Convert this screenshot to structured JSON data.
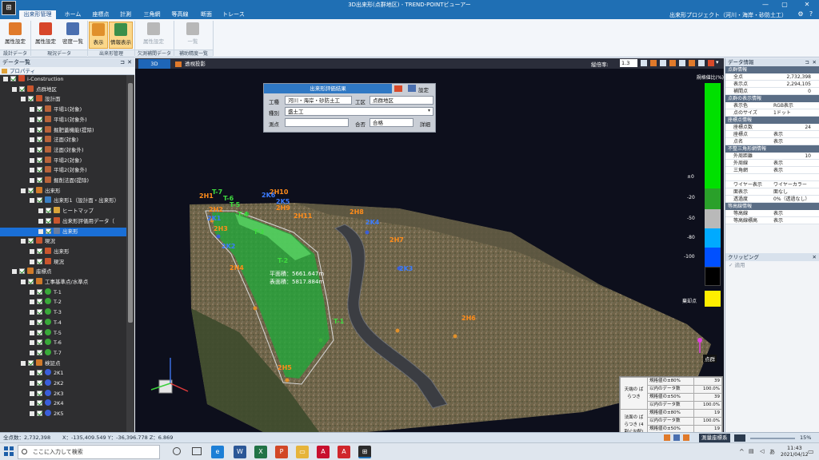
{
  "window": {
    "title": "3D出来形(点群地区) - TREND-POINTビューアー",
    "min_glyph": "—",
    "max_glyph": "▢",
    "close_glyph": "✕"
  },
  "ribbon_tabs": [
    {
      "label": "出来形管理",
      "active": true
    },
    {
      "label": "ホーム"
    },
    {
      "label": "座標点"
    },
    {
      "label": "計測"
    },
    {
      "label": "三角網"
    },
    {
      "label": "等高線"
    },
    {
      "label": "断面"
    },
    {
      "label": "トレース"
    }
  ],
  "project_label": "出来形プロジェクト（河川・海岸・砂防土工）",
  "help_glyph": "?",
  "ribbon": {
    "buttons": [
      {
        "label": "属性設定",
        "color": "#e07a2b"
      },
      {
        "label": "属性設定",
        "color": "#d7462a"
      },
      {
        "label": "密度一覧",
        "color": "#4a6fb0"
      },
      {
        "label": "表示",
        "color": "#e0902b",
        "pressed": true
      },
      {
        "label": "情報表示",
        "color": "#3b8f4a",
        "pressed": true
      },
      {
        "label": "属性設定",
        "color": "#b8b8b8",
        "disabled": true
      },
      {
        "label": "一覧",
        "color": "#b8b8b8",
        "disabled": true
      }
    ],
    "groups": [
      "設計データ",
      "現況データ",
      "出来形管理",
      "欠測補間データ",
      "補助精度一覧"
    ]
  },
  "left_panel": {
    "title": "データ一覧",
    "property_tab": "プロパティ",
    "pin_glyph": "⊐",
    "close_glyph": "✕",
    "tree": [
      {
        "label": "i-Construction",
        "indent": 0,
        "icon": "#d04a2a"
      },
      {
        "label": "点群地区",
        "indent": 1,
        "icon": "#c9562e"
      },
      {
        "label": "設計面",
        "indent": 2,
        "icon": "#c9562e"
      },
      {
        "label": "平場1(対象)",
        "indent": 3,
        "icon": "#b8643b"
      },
      {
        "label": "平場1(対象外)",
        "indent": 3,
        "icon": "#b8643b"
      },
      {
        "label": "掘肥蓋機能(提除)",
        "indent": 3,
        "icon": "#b8643b"
      },
      {
        "label": "法面(対象)",
        "indent": 3,
        "icon": "#b8643b"
      },
      {
        "label": "法面(対象外)",
        "indent": 3,
        "icon": "#b8643b"
      },
      {
        "label": "平場2(対象)",
        "indent": 3,
        "icon": "#b8643b"
      },
      {
        "label": "平場2(対象外)",
        "indent": 3,
        "icon": "#b8643b"
      },
      {
        "label": "掘削法面(提除)",
        "indent": 3,
        "icon": "#b8643b"
      },
      {
        "label": "出来形",
        "indent": 2,
        "icon": "#d07a2a"
      },
      {
        "label": "出来形1（設計面・出来形）",
        "indent": 3,
        "icon": "#3a7fc4"
      },
      {
        "label": "ヒートマップ",
        "indent": 4,
        "icon": "#d9a43a"
      },
      {
        "label": "出来形評価用データ（",
        "indent": 4,
        "icon": "#c9562e"
      },
      {
        "label": "出来形",
        "indent": 4,
        "icon": "#6b7fa0",
        "selected": true
      },
      {
        "label": "現況",
        "indent": 2,
        "icon": "#c9562e"
      },
      {
        "label": "出来形",
        "indent": 3,
        "icon": "#c9562e"
      },
      {
        "label": "現況",
        "indent": 3,
        "icon": "#c9562e"
      },
      {
        "label": "座標点",
        "indent": 1,
        "icon": "#d07a2a"
      },
      {
        "label": "工事基準点/水準点",
        "indent": 2,
        "icon": "#d07a2a"
      },
      {
        "label": "T-1",
        "indent": 3,
        "icon": "#3aaa3a",
        "ball": true
      },
      {
        "label": "T-2",
        "indent": 3,
        "icon": "#3aaa3a",
        "ball": true
      },
      {
        "label": "T-3",
        "indent": 3,
        "icon": "#3aaa3a",
        "ball": true
      },
      {
        "label": "T-4",
        "indent": 3,
        "icon": "#3aaa3a",
        "ball": true
      },
      {
        "label": "T-5",
        "indent": 3,
        "icon": "#3aaa3a",
        "ball": true
      },
      {
        "label": "T-6",
        "indent": 3,
        "icon": "#3aaa3a",
        "ball": true
      },
      {
        "label": "T-7",
        "indent": 3,
        "icon": "#3aaa3a",
        "ball": true
      },
      {
        "label": "検証点",
        "indent": 2,
        "icon": "#d07a2a"
      },
      {
        "label": "2K1",
        "indent": 3,
        "icon": "#3b5fd9",
        "ball": true
      },
      {
        "label": "2K2",
        "indent": 3,
        "icon": "#3b5fd9",
        "ball": true
      },
      {
        "label": "2K3",
        "indent": 3,
        "icon": "#3b5fd9",
        "ball": true
      },
      {
        "label": "2K4",
        "indent": 3,
        "icon": "#3b5fd9",
        "ball": true
      },
      {
        "label": "2K5",
        "indent": 3,
        "icon": "#3b5fd9",
        "ball": true
      }
    ]
  },
  "view_tabs": [
    "3D",
    "透視投影"
  ],
  "view_toolbar": {
    "label": "縦倍率:",
    "value": "1.3"
  },
  "eval_dialog": {
    "title": "出来形評価結果",
    "setting_label": "設定",
    "work_type_label": "工種",
    "work_type_value": "河川・海岸・砂防土工",
    "section_label": "工区",
    "section_value": "点群地区",
    "kind_label": "種別",
    "kind_value": "盛土工",
    "survey_label": "測点",
    "survey_value": "",
    "result_label": "合否",
    "result_value": "合格",
    "detail_label": "詳細"
  },
  "scene_labels": {
    "green": [
      "T-7",
      "T-6",
      "T-5",
      "T-4",
      "T-3",
      "T-2",
      "T-1"
    ],
    "orange": [
      "2H1",
      "2H2",
      "2H3",
      "2H4",
      "2H5",
      "2H6",
      "2H7",
      "2H8",
      "2H9",
      "2H10",
      "2H11"
    ],
    "blue": [
      "2K1",
      "2K2",
      "2K3",
      "2K4",
      "2K5",
      "2K6"
    ],
    "area": [
      "平面積：5661.647m",
      "表面積：5817.884m"
    ],
    "point_cloud_label": "点群"
  },
  "scale": {
    "title": "規格値比(%)",
    "ticks": [
      "±0",
      "-20",
      "-50",
      "-80",
      "-100"
    ],
    "missing_label": "棄却点",
    "colors": [
      "#00e000",
      "#00e000",
      "#2aa02a",
      "#b9b9b9",
      "#00aaff",
      "#0050ff",
      "#000000",
      "#ffee00"
    ]
  },
  "stats": {
    "rows": [
      {
        "group": "天端の ばらつき",
        "a": "規格値の±80%",
        "b": "39"
      },
      {
        "group": "",
        "a": "以内のデータ数",
        "b": "100.0%"
      },
      {
        "group": "",
        "a": "規格値の±50%",
        "b": "39"
      },
      {
        "group": "",
        "a": "以内のデータ数",
        "b": "100.0%"
      },
      {
        "group": "法面の ばらつき (4割ぐ勾配)",
        "a": "規格値の±80%",
        "b": "19"
      },
      {
        "group": "",
        "a": "以内のデータ数",
        "b": "100.0%"
      },
      {
        "group": "",
        "a": "規格値の±50%",
        "b": "19"
      },
      {
        "group": "",
        "a": "以内のデータ数",
        "b": "100.0%"
      }
    ]
  },
  "right_panel": {
    "title": "データ情報",
    "sections": [
      {
        "name": "点群情報",
        "rows": [
          [
            "全点",
            "2,732,398"
          ],
          [
            "表示点",
            "2,294,105"
          ],
          [
            "補間点",
            "0"
          ]
        ]
      },
      {
        "name": "点群の表示情報",
        "rows": [
          [
            "表示色",
            "RGB表示"
          ],
          [
            "点のサイズ",
            "1ドット"
          ]
        ]
      },
      {
        "name": "座標点情報",
        "rows": [
          [
            "座標点数",
            "24"
          ],
          [
            "座標点",
            "表示"
          ],
          [
            "点名",
            "表示"
          ]
        ]
      },
      {
        "name": "不整三角形網情報",
        "rows": [
          [
            "外周距離",
            "10"
          ],
          [
            "外周線",
            "表示"
          ],
          [
            "三角網",
            "表示"
          ],
          [
            "",
            ""
          ],
          [
            "ワイヤー表示",
            "ワイヤーカラー"
          ],
          [
            "面表示",
            "面なし"
          ],
          [
            "透過度",
            "0%（透過なし）"
          ]
        ]
      },
      {
        "name": "等高線情報",
        "rows": [
          [
            "等高線",
            "表示"
          ],
          [
            "等高線標高",
            "表示"
          ]
        ]
      }
    ],
    "clipping_title": "クリッピング",
    "clipping_apply": "適用"
  },
  "status": {
    "total": "全点数：2,732,398",
    "coords": "X：-135,409.549  Y：-36,396.778  Z：6.869",
    "coord_mode": "測量座標系",
    "zoom": "15%"
  },
  "taskbar": {
    "search_placeholder": "ここに入力して検索",
    "time": "11:43",
    "date": "2021/04/12"
  }
}
